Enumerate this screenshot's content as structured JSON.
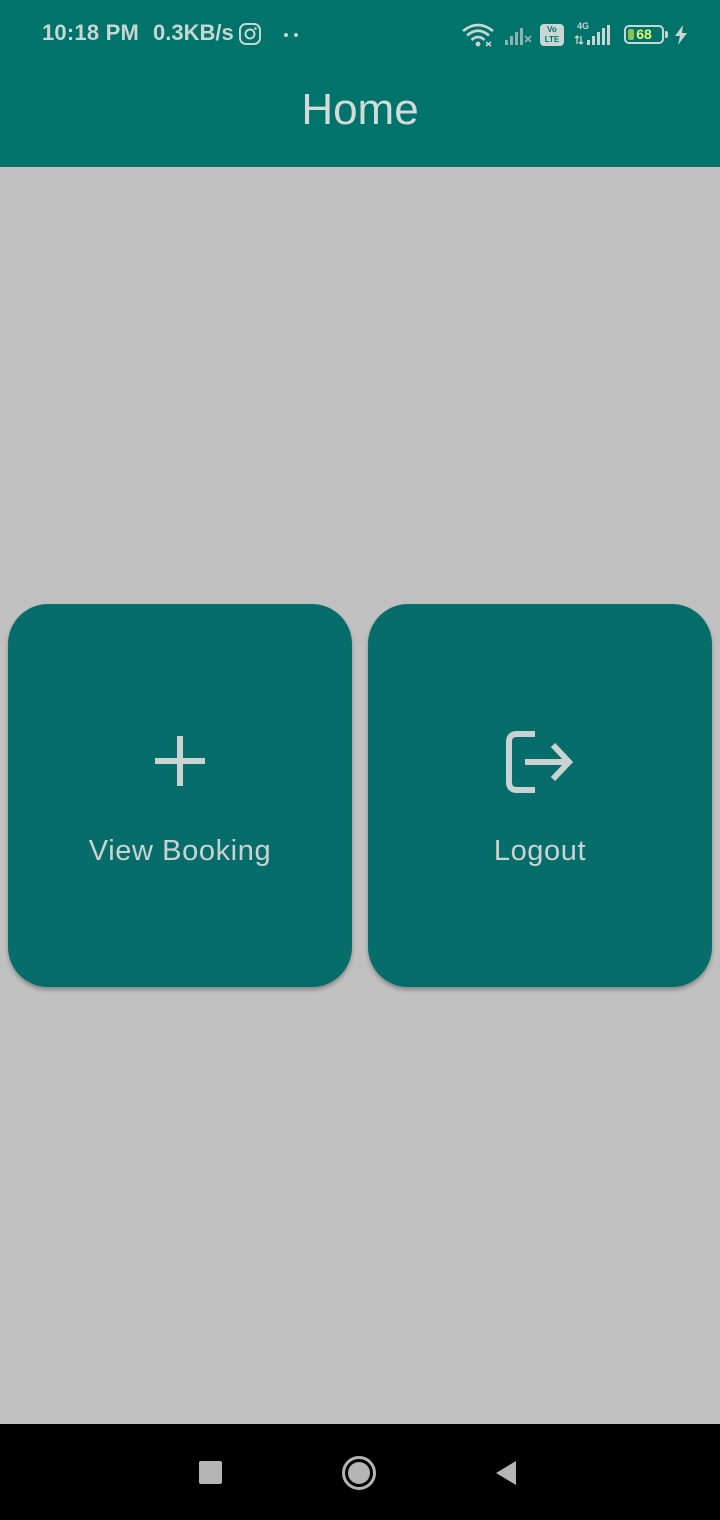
{
  "status_bar": {
    "time": "10:18 PM",
    "net_speed": "0.3KB/s",
    "volte_label": "Vo LTE",
    "network_type": "4G",
    "battery_level": "68",
    "icons": [
      "instagram-icon",
      "more-dots-icon",
      "wifi-icon",
      "signal-icon",
      "volte-icon",
      "signal-4g-icon",
      "battery-icon",
      "charging-icon"
    ]
  },
  "app_bar": {
    "title": "Home"
  },
  "cards": [
    {
      "label": "View Booking",
      "icon": "plus-icon"
    },
    {
      "label": "Logout",
      "icon": "logout-icon"
    }
  ],
  "nav_bar": {
    "icons": [
      "recents-icon",
      "home-icon",
      "back-icon"
    ]
  },
  "colors": {
    "primary": "#00736a",
    "card": "#066d6a",
    "background": "#c1c1c1",
    "on_primary_text": "#d3dbda"
  }
}
